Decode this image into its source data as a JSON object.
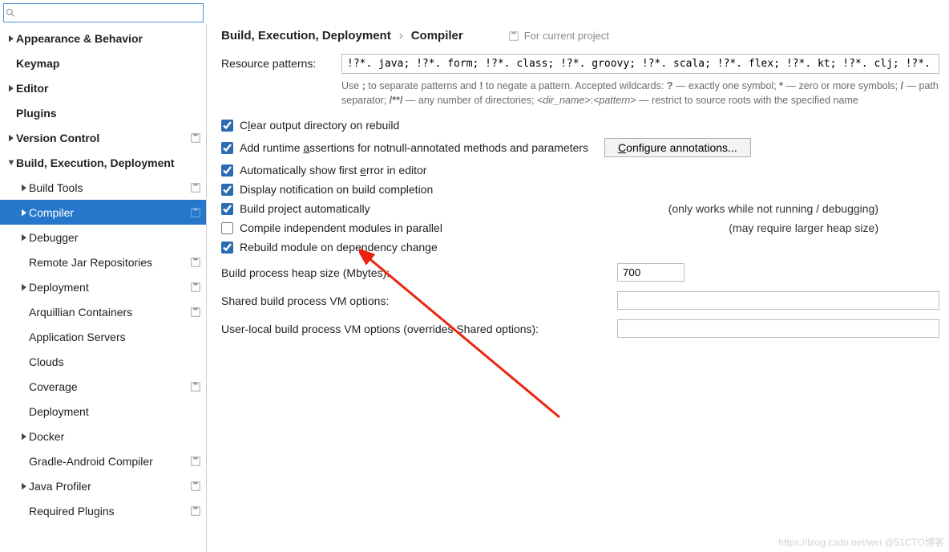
{
  "search": {
    "placeholder": ""
  },
  "sidebar": {
    "items": [
      {
        "label": "Appearance & Behavior",
        "depth": 0,
        "bold": true,
        "caret": "right",
        "proj": false
      },
      {
        "label": "Keymap",
        "depth": 0,
        "bold": true,
        "caret": "none",
        "proj": false
      },
      {
        "label": "Editor",
        "depth": 0,
        "bold": true,
        "caret": "right",
        "proj": false
      },
      {
        "label": "Plugins",
        "depth": 0,
        "bold": true,
        "caret": "none",
        "proj": false
      },
      {
        "label": "Version Control",
        "depth": 0,
        "bold": true,
        "caret": "right",
        "proj": true
      },
      {
        "label": "Build, Execution, Deployment",
        "depth": 0,
        "bold": true,
        "caret": "down",
        "proj": false
      },
      {
        "label": "Build Tools",
        "depth": 1,
        "bold": false,
        "caret": "right",
        "proj": true
      },
      {
        "label": "Compiler",
        "depth": 1,
        "bold": false,
        "caret": "right",
        "proj": true,
        "selected": true
      },
      {
        "label": "Debugger",
        "depth": 1,
        "bold": false,
        "caret": "right",
        "proj": false
      },
      {
        "label": "Remote Jar Repositories",
        "depth": 1,
        "bold": false,
        "caret": "none",
        "proj": true
      },
      {
        "label": "Deployment",
        "depth": 1,
        "bold": false,
        "caret": "right",
        "proj": true
      },
      {
        "label": "Arquillian Containers",
        "depth": 1,
        "bold": false,
        "caret": "none",
        "proj": true
      },
      {
        "label": "Application Servers",
        "depth": 1,
        "bold": false,
        "caret": "none",
        "proj": false
      },
      {
        "label": "Clouds",
        "depth": 1,
        "bold": false,
        "caret": "none",
        "proj": false
      },
      {
        "label": "Coverage",
        "depth": 1,
        "bold": false,
        "caret": "none",
        "proj": true
      },
      {
        "label": "Deployment",
        "depth": 1,
        "bold": false,
        "caret": "none",
        "proj": false
      },
      {
        "label": "Docker",
        "depth": 1,
        "bold": false,
        "caret": "right",
        "proj": false
      },
      {
        "label": "Gradle-Android Compiler",
        "depth": 1,
        "bold": false,
        "caret": "none",
        "proj": true
      },
      {
        "label": "Java Profiler",
        "depth": 1,
        "bold": false,
        "caret": "right",
        "proj": true
      },
      {
        "label": "Required Plugins",
        "depth": 1,
        "bold": false,
        "caret": "none",
        "proj": true
      }
    ]
  },
  "breadcrumb": {
    "a": "Build, Execution, Deployment",
    "sep": "›",
    "b": "Compiler"
  },
  "scope": "For current project",
  "resource": {
    "label": "Resource patterns:",
    "value": "!?*. java; !?*. form; !?*. class; !?*. groovy; !?*. scala; !?*. flex; !?*. kt; !?*. clj; !?*. aj",
    "hint_pre": "Use ",
    "hint_sep": ";",
    "hint_1": " to separate patterns and ",
    "hint_neg": "!",
    "hint_2": " to negate a pattern. Accepted wildcards: ",
    "hint_q": "?",
    "hint_3": " — exactly one symbol; ",
    "hint_star": "*",
    "hint_4": " — zero or more symbols; ",
    "hint_slash": "/",
    "hint_5": " — path separator; ",
    "hint_dstar": "/**/",
    "hint_6": " — any number of directories; ",
    "hint_dir": "<dir_name>",
    "hint_colon": ":",
    "hint_pat": "<pattern>",
    "hint_7": " — restrict to source roots with the specified name"
  },
  "checks": {
    "clear": "Clear output directory on rebuild",
    "asserts": "Add runtime assertions for notnull-annotated methods and parameters",
    "configure": "Configure annotations...",
    "firsterr": "Automatically show first error in editor",
    "notify": "Display notification on build completion",
    "auto": "Build project automatically",
    "auto_note": "(only works while not running / debugging)",
    "parallel": "Compile independent modules in parallel",
    "parallel_note": "(may require larger heap size)",
    "rebuild": "Rebuild module on dependency change"
  },
  "fields": {
    "heap_label": "Build process heap size (Mbytes):",
    "heap_value": "700",
    "shared_label": "Shared build process VM options:",
    "shared_value": "",
    "user_label": "User-local build process VM options (overrides Shared options):",
    "user_value": ""
  },
  "watermark": "https://blog.csdn.net/wei @51CTO博客"
}
